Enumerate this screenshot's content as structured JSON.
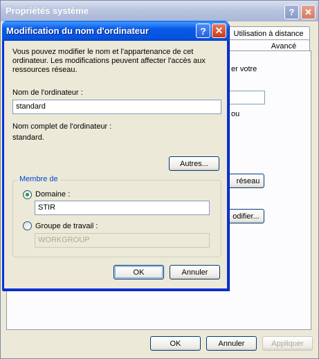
{
  "background_window": {
    "title": "Propriétés système",
    "tabs": [
      "Utilisation à distance",
      "Avancé"
    ],
    "partial_texts": [
      "er votre",
      "ou"
    ],
    "buttons": {
      "network": "réseau",
      "modify": "odifier...",
      "ok": "OK",
      "cancel": "Annuler",
      "apply": "Appliquer"
    }
  },
  "dialog": {
    "title": "Modification du nom d'ordinateur",
    "description_lines": [
      "Vous pouvez modifier le nom et l'appartenance de cet",
      "ordinateur. Les modifications peuvent affecter l'accès aux",
      "ressources réseau."
    ],
    "computer_name_label": "Nom de l'ordinateur :",
    "computer_name_value": "standard",
    "full_name_label": "Nom complet de l'ordinateur :",
    "full_name_value": "standard.",
    "more_button": "Autres...",
    "member_of_label": "Membre de",
    "domain_label": "Domaine :",
    "domain_value": "STIR",
    "workgroup_label": "Groupe de travail :",
    "workgroup_value": "WORKGROUP",
    "ok_button": "OK",
    "cancel_button": "Annuler"
  },
  "colors": {
    "dialog_title_blue": "#0a5ae6",
    "groupbox_legend": "#0046d5",
    "radio_selected": "#21a121"
  },
  "icons": {
    "help": "question-mark",
    "close": "x-mark"
  }
}
